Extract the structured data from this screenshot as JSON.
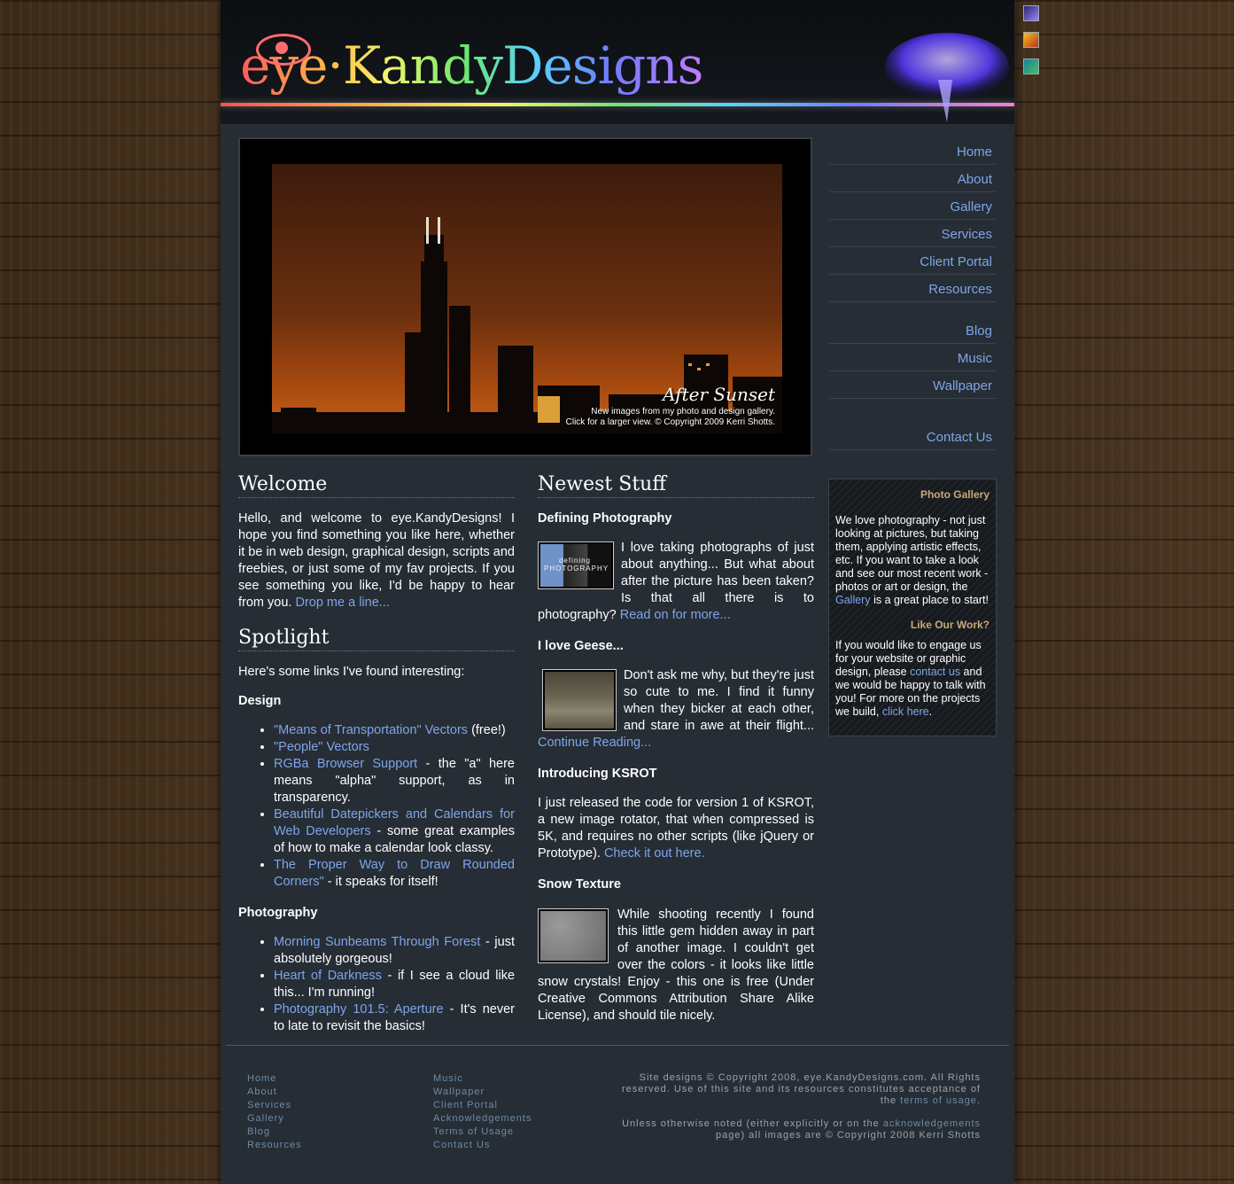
{
  "header": {
    "logo_text": "eye·KandyDesigns"
  },
  "feature": {
    "title": "After Sunset",
    "caption_line1": "New images from my photo and design gallery.",
    "caption_line2": "Click for a larger view. © Copyright 2009 Kerri Shotts."
  },
  "nav": {
    "group1": [
      "Home",
      "About",
      "Gallery",
      "Services",
      "Client Portal",
      "Resources"
    ],
    "group2": [
      "Blog",
      "Music",
      "Wallpaper"
    ],
    "group3": [
      "Contact Us"
    ]
  },
  "welcome": {
    "heading": "Welcome",
    "text": "Hello, and welcome to eye.KandyDesigns! I hope you find something you like here, whether it be in web design, graphical design, scripts and freebies, or just some of my fav projects. If you see something you like, I'd be happy to hear from you.",
    "link": "Drop me a line..."
  },
  "spotlight": {
    "heading": "Spotlight",
    "intro": "Here's some links I've found interesting:",
    "design_heading": "Design",
    "design_items": [
      {
        "link": "\"Means of Transportation\" Vectors",
        "text": " (free!)"
      },
      {
        "link": "\"People\" Vectors",
        "text": ""
      },
      {
        "link": "RGBa Browser Support",
        "text": " - the \"a\" here means \"alpha\" support, as in transparency."
      },
      {
        "link": "Beautiful Datepickers and Calendars for Web Developers",
        "text": " - some great examples of how to make a calendar look classy."
      },
      {
        "link": "The Proper Way to Draw Rounded Corners\"",
        "text": " - it speaks for itself!"
      }
    ],
    "photo_heading": "Photography",
    "photo_items": [
      {
        "link": "Morning Sunbeams Through Forest",
        "text": " - just absolutely gorgeous!"
      },
      {
        "link": "Heart of Darkness",
        "text": " - if I see a cloud like this... I'm running!"
      },
      {
        "link": "Photography 101.5: Aperture",
        "text": " - It's never to late to revisit the basics!"
      }
    ]
  },
  "newest": {
    "heading": "Newest Stuff",
    "items": [
      {
        "title": "Defining Photography",
        "text": "I love taking photographs of just about anything... But what about after the picture has been taken? Is that all there is to photography? ",
        "link": "Read on for more...",
        "thumb_label": "defining PHOTOGRAPHY"
      },
      {
        "title": "I love Geese...",
        "text": "Don't ask me why, but they're just so cute to me. I find it funny when they bicker at each other, and stare in awe at their flight... ",
        "link": "Continue Reading..."
      },
      {
        "title": "Introducing KSROT",
        "text": "I just released the code for version 1 of KSROT, a new image rotator, that when compressed is 5K, and requires no other scripts (like jQuery or Prototype). ",
        "link": "Check it out here."
      },
      {
        "title": "Snow Texture",
        "text": "While shooting recently I found this little gem hidden away in part of another image. I couldn't get over the colors - it looks like little snow crystals! Enjoy - this one is free (Under Creative Commons Attribution Share Alike License), and should tile nicely."
      }
    ]
  },
  "sidebox": {
    "gallery_heading": "Photo Gallery",
    "gallery_text1": "We love photography - not just looking at pictures, but taking them, applying artistic effects, etc. If you want to take a look and see our most recent work - photos or art or design, the ",
    "gallery_link": "Gallery",
    "gallery_text2": " is a great place to start!",
    "work_heading": "Like Our Work?",
    "work_text1": "If you would like to engage us for your website or graphic design, please ",
    "work_link1": "contact us",
    "work_text2": " and we would be happy to talk with you! For more on the projects we build, ",
    "work_link2": "click here",
    "work_text3": "."
  },
  "footer": {
    "col1": [
      "Home",
      "About",
      "Services",
      "Gallery",
      "Blog",
      "Resources"
    ],
    "col2": [
      "Music",
      "Wallpaper",
      "Client Portal",
      "Acknowledgements",
      "Terms of Usage",
      "Contact Us"
    ],
    "copyright1": "Site designs © Copyright 2008, eye.KandyDesigns.com. All Rights reserved. Use of this site and its resources constitutes acceptance of the ",
    "terms_link": "terms of usage",
    "copyright1_end": ".",
    "copyright2": "Unless otherwise noted (either explicitly or on the ",
    "ack_link": "acknowledgements",
    "copyright2_end": " page) all images are © Copyright 2008 Kerri Shotts"
  }
}
